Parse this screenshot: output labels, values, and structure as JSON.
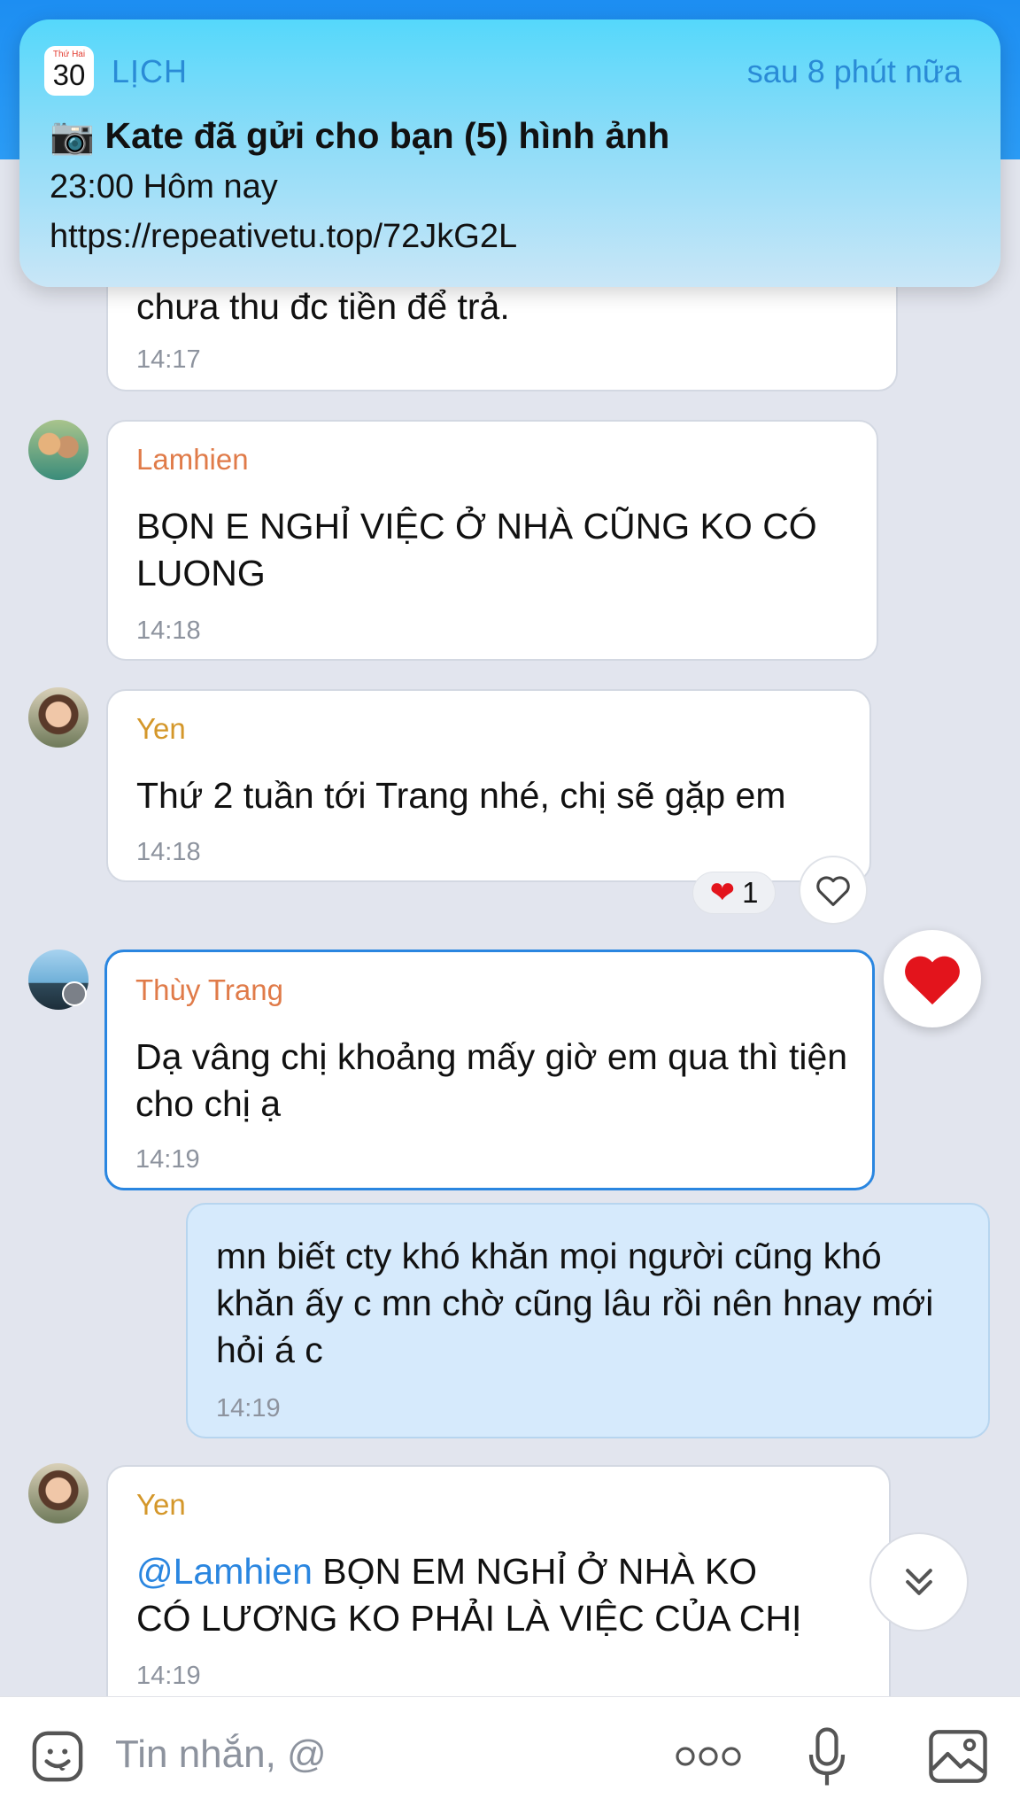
{
  "notification": {
    "app_name": "LỊCH",
    "calendar_weekday": "Thứ Hai",
    "calendar_day": "30",
    "time_hint": "sau 8 phút nữa",
    "title": "Kate đã gửi cho bạn (5) hình ảnh",
    "title_emoji": "📷",
    "event_time": "23:00 Hôm nay",
    "link": "https://repeativetu.top/72JkG2L"
  },
  "messages": [
    {
      "sender": "",
      "text": "chưa thu đc tiền để trả.",
      "time": "14:17"
    },
    {
      "sender": "Lamhien",
      "text": "BỌN E NGHỈ VIỆC Ở NHÀ CŨNG KO CÓ LUONG",
      "time": "14:18"
    },
    {
      "sender": "Yen",
      "text": "Thứ 2 tuần tới Trang nhé, chị sẽ gặp em",
      "time": "14:18"
    },
    {
      "sender": "Thùy Trang",
      "text": "Dạ vâng chị khoảng mấy giờ em qua thì tiện cho chị ạ",
      "time": "14:19"
    },
    {
      "sender": "",
      "text": "mn biết cty khó khăn mọi người cũng khó khăn ấy c mn chờ cũng lâu rồi nên hnay mới hỏi á c",
      "time": "14:19"
    },
    {
      "sender": "Yen",
      "mention": "@Lamhien",
      "text": " BỌN EM NGHỈ Ở NHÀ KO CÓ LƯƠNG KO PHẢI LÀ VIỆC CỦA CHỊ",
      "time": "14:19"
    }
  ],
  "reactions": {
    "heart_count": "1"
  },
  "composer": {
    "placeholder": "Tin nhắn, @",
    "more_label": "ooo"
  },
  "colors": {
    "accent": "#2a86e0",
    "name_orange": "#e07b49",
    "name_yen": "#d4972a",
    "mine_bubble": "#d6eafc",
    "heart": "#e3141c"
  }
}
